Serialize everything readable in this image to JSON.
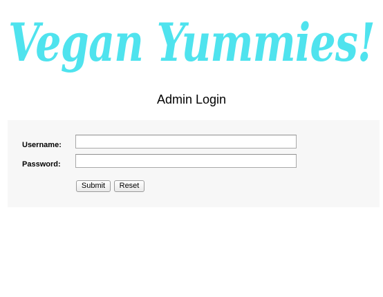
{
  "site": {
    "logo_text": "Vegan Yummies!",
    "logo_color": "#4fe3ee"
  },
  "page": {
    "title": "Admin Login"
  },
  "form": {
    "username_label": "Username:",
    "username_value": "",
    "password_label": "Password:",
    "password_value": "",
    "submit_label": "Submit",
    "reset_label": "Reset",
    "panel_color": "#f7f7f7"
  }
}
